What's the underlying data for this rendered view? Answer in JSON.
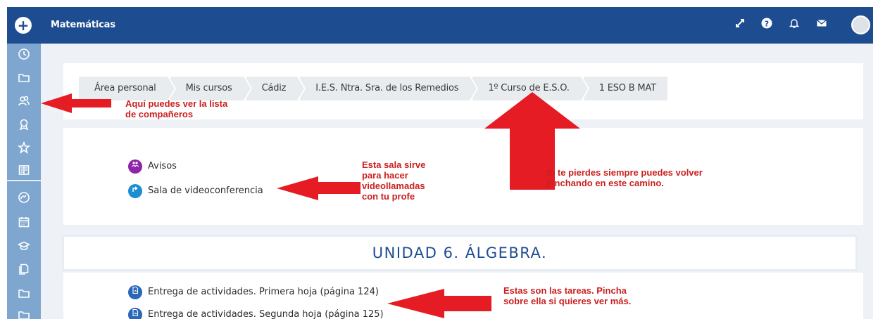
{
  "navbar": {
    "brand": "Matemáticas",
    "add_icon": "+",
    "icons": [
      "fullscreen-icon",
      "help-icon",
      "bell-icon",
      "mail-icon"
    ],
    "colors": {
      "bar": "#1d4c91",
      "sidebar": "#7ea6cf"
    }
  },
  "sidebar": {
    "icons": [
      "clock-icon",
      "folder-icon",
      "participants-icon",
      "badge-icon",
      "star-icon",
      "grades-icon",
      "dashboard-icon",
      "calendar-icon",
      "graduation-icon",
      "files-icon",
      "folder-icon",
      "folder-icon"
    ]
  },
  "breadcrumb": [
    "Área personal",
    "Mis cursos",
    "Cádiz",
    "I.E.S. Ntra. Sra. de los Remedios",
    "1º Curso de E.S.O.",
    "1 ESO B MAT"
  ],
  "section": {
    "activities": [
      {
        "name": "Avisos",
        "icon": "forum-icon",
        "color": "#8e24aa"
      },
      {
        "name": "Sala de videoconferencia",
        "icon": "url-icon",
        "color": "#1a8fd3"
      }
    ]
  },
  "unit": {
    "title": "UNIDAD 6. ÁLGEBRA."
  },
  "tasks": [
    {
      "name": "Entrega de actividades. Primera hoja (página 124)",
      "icon": "assignment-icon",
      "color": "#2a67b8"
    },
    {
      "name": "Entrega de actividades. Segunda hoja (página 125)",
      "icon": "assignment-icon",
      "color": "#2a67b8"
    }
  ],
  "annotations": {
    "participants": "Aquí puedes ver la lista\nde compañeros",
    "videoconference": "Esta sala sirve\npara hacer\nvideollamadas\ncon tu profe",
    "breadcrumb": "Si te pierdes siempre puedes volver\npinchando en este camino.",
    "tasks": "Estas son las tareas. Pincha\nsobre ella si quieres ver más.",
    "color": "#e51c23"
  }
}
